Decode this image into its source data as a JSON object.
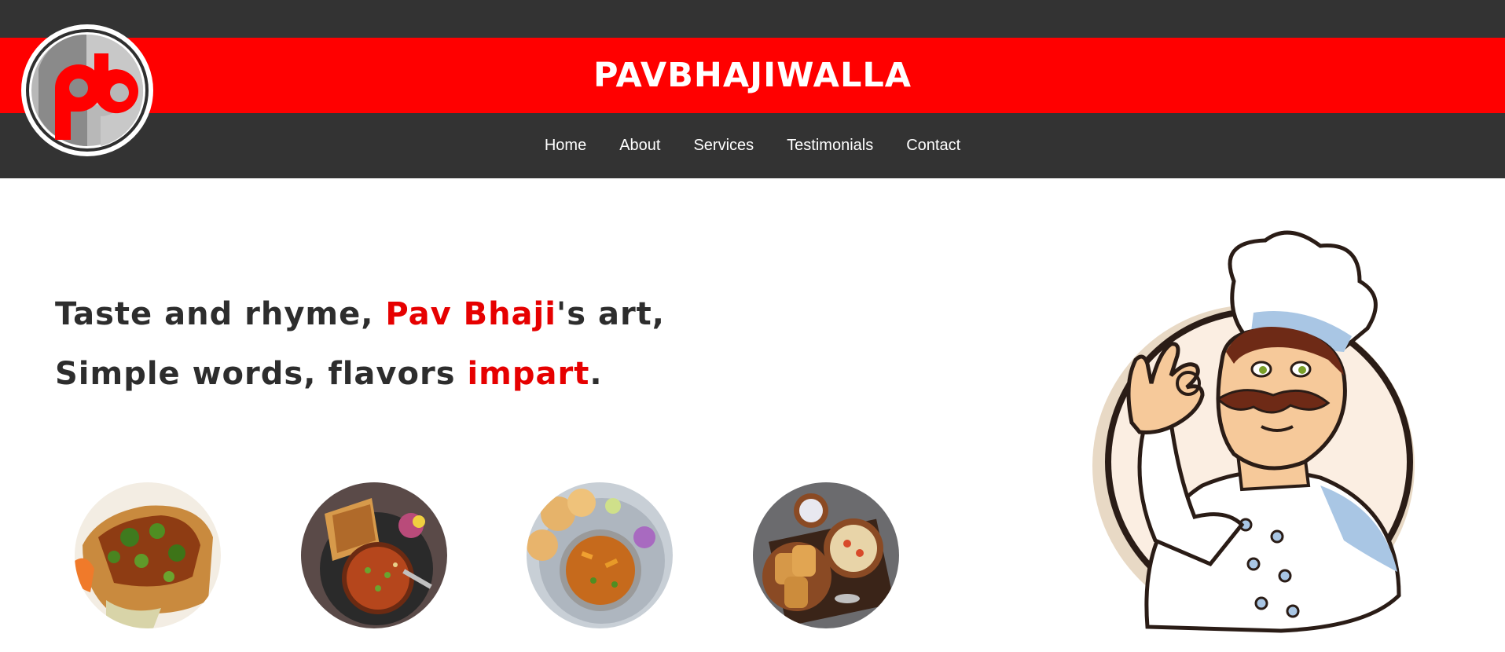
{
  "header": {
    "brand": "PAVBHAJIWALLA",
    "logo_icon": "pb-monogram-logo"
  },
  "nav": {
    "items": [
      {
        "label": "Home"
      },
      {
        "label": "About"
      },
      {
        "label": "Services"
      },
      {
        "label": "Testimonials"
      },
      {
        "label": "Contact"
      }
    ]
  },
  "hero": {
    "line1": {
      "a": "Taste and rhyme, ",
      "b": "Pav Bhaji",
      "c": "'s art,"
    },
    "line2": {
      "a": "Simple words, flavors ",
      "b": "impart",
      "c": "."
    }
  },
  "dishes": [
    {
      "icon": "pav-bhaji-toast-image"
    },
    {
      "icon": "bhaji-bowl-with-pav-image"
    },
    {
      "icon": "masala-pav-bowl-image"
    },
    {
      "icon": "pav-and-bhaji-platter-image"
    }
  ],
  "illustration": {
    "icon": "chef-mascot-illustration"
  },
  "colors": {
    "accent": "#ff0000",
    "dark": "#333333",
    "text": "#2d2d2d"
  }
}
